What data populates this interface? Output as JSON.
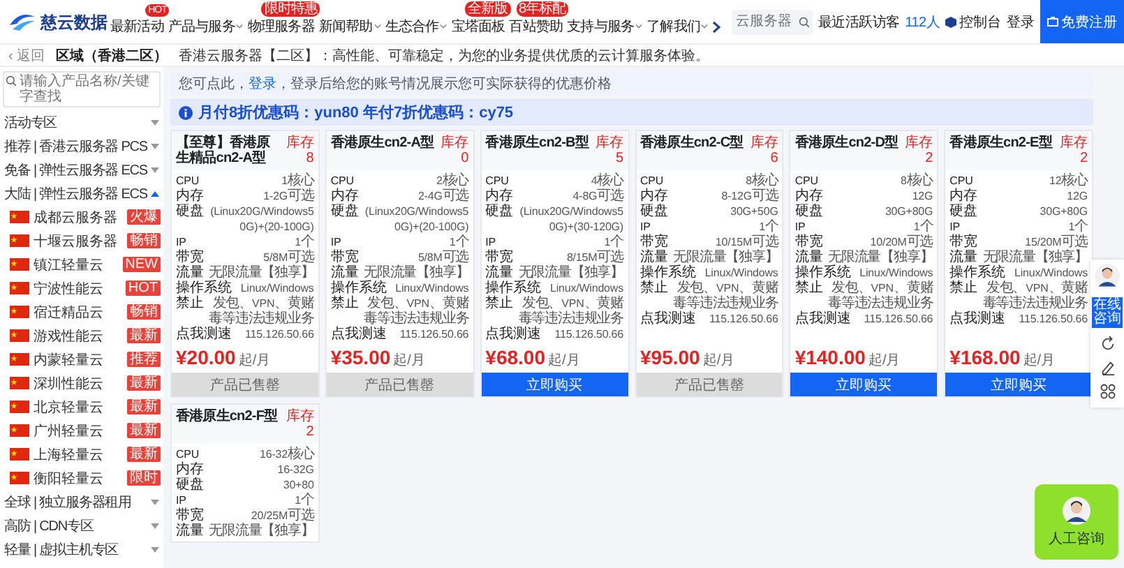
{
  "header": {
    "logo": "慈云数据",
    "nav": [
      {
        "label": "最新活动",
        "dropdown": false,
        "badge": "HOT"
      },
      {
        "label": "产品与服务",
        "dropdown": true
      },
      {
        "label": "物理服务器",
        "dropdown": false,
        "badge": "限时特惠"
      },
      {
        "label": "新闻帮助",
        "dropdown": true
      },
      {
        "label": "生态合作",
        "dropdown": true
      },
      {
        "label": "宝塔面板",
        "dropdown": false,
        "badge": "全新版"
      },
      {
        "label": "百站赞助",
        "dropdown": false,
        "badge": "8年标配"
      },
      {
        "label": "支持与服务",
        "dropdown": true
      },
      {
        "label": "了解我们",
        "dropdown": true
      }
    ],
    "search": {
      "placeholder": "云服务器"
    },
    "visitors_label": "最近活跃访客",
    "visitors_count": "112人",
    "console": "控制台",
    "login": "登录",
    "register": "免费注册"
  },
  "breadcrumb": {
    "back": "‹ 返回",
    "title": "区域（香港二区）",
    "description": "香港云服务器【二区】：高性能、可靠稳定，为您的业务提供优质的云计算服务体验。"
  },
  "sidebar": {
    "search": {
      "placeholder": "请输入产品名称/关键字查找"
    },
    "groups": [
      {
        "label": "活动专区",
        "expanded": false
      },
      {
        "label": "推荐 | 香港云服务器 PCS",
        "expanded": false
      },
      {
        "label": "免备 | 弹性云服务器 ECS",
        "expanded": false
      },
      {
        "label": "大陆 | 弹性云服务器 ECS",
        "expanded": true,
        "children": [
          {
            "label": "成都云服务器",
            "badge": "火爆"
          },
          {
            "label": "十堰云服务器",
            "badge": "畅销"
          },
          {
            "label": "镇江轻量云",
            "badge": "NEW"
          },
          {
            "label": "宁波性能云",
            "badge": "HOT"
          },
          {
            "label": "宿迁精品云",
            "badge": "畅销"
          },
          {
            "label": "游戏性能云",
            "badge": "最新"
          },
          {
            "label": "内蒙轻量云",
            "badge": "推荐"
          },
          {
            "label": "深圳性能云",
            "badge": "最新"
          },
          {
            "label": "北京轻量云",
            "badge": "最新"
          },
          {
            "label": "广州轻量云",
            "badge": "最新"
          },
          {
            "label": "上海轻量云",
            "badge": "最新"
          },
          {
            "label": "衡阳轻量云",
            "badge": "限时"
          }
        ]
      },
      {
        "label": "全球 | 独立服务器租用",
        "expanded": false
      },
      {
        "label": "高防 | CDN专区",
        "expanded": false
      },
      {
        "label": "轻量 | 虚拟主机专区",
        "expanded": false
      }
    ]
  },
  "notice": {
    "prefix": "您可点此，",
    "link": "登录",
    "suffix": "，登录后给您的账号情况展示您可实际获得的优惠价格"
  },
  "promo": "月付8折优惠码：yun80 年付7折优惠码：cy75",
  "plans": [
    {
      "title": "【至尊】香港原生精品cn2-A型",
      "stock": "库存8",
      "specs": [
        {
          "label": "CPU",
          "value": "1核心"
        },
        {
          "label": "内存",
          "value": "1-2G可选"
        },
        {
          "label": "硬盘",
          "value": "(Linux20G/Windows50G)+(20-100G)"
        },
        {
          "label": "IP",
          "value": "1个"
        },
        {
          "label": "带宽",
          "value": "5/8M可选"
        },
        {
          "label": "流量",
          "value": "无限流量【独享】"
        },
        {
          "label": "操作系统",
          "value": "Linux/Windows"
        },
        {
          "label": "禁止",
          "value": "发包、VPN、黄赌毒等违法违规业务"
        },
        {
          "label": "点我测速",
          "value": "115.126.50.66"
        }
      ],
      "price": "¥20.00",
      "unit": "起/月",
      "button": {
        "label": "产品已售罄",
        "kind": "soldout"
      }
    },
    {
      "title": "香港原生cn2-A型",
      "stock": "库存0",
      "specs": [
        {
          "label": "CPU",
          "value": "2核心"
        },
        {
          "label": "内存",
          "value": "2-4G可选"
        },
        {
          "label": "硬盘",
          "value": "(Linux20G/Windows50G)+(20-100G)"
        },
        {
          "label": "IP",
          "value": "1个"
        },
        {
          "label": "带宽",
          "value": "5/8M可选"
        },
        {
          "label": "流量",
          "value": "无限流量【独享】"
        },
        {
          "label": "操作系统",
          "value": "Linux/Windows"
        },
        {
          "label": "禁止",
          "value": "发包、VPN、黄赌毒等违法违规业务"
        },
        {
          "label": "点我测速",
          "value": "115.126.50.66"
        }
      ],
      "price": "¥35.00",
      "unit": "起/月",
      "button": {
        "label": "产品已售罄",
        "kind": "soldout"
      }
    },
    {
      "title": "香港原生cn2-B型",
      "stock": "库存5",
      "specs": [
        {
          "label": "CPU",
          "value": "4核心"
        },
        {
          "label": "内存",
          "value": "4-8G可选"
        },
        {
          "label": "硬盘",
          "value": "(Linux20G/Windows50G)+(30-120G)"
        },
        {
          "label": "IP",
          "value": "1个"
        },
        {
          "label": "带宽",
          "value": "8/15M可选"
        },
        {
          "label": "流量",
          "value": "无限流量【独享】"
        },
        {
          "label": "操作系统",
          "value": "Linux/Windows"
        },
        {
          "label": "禁止",
          "value": "发包、VPN、黄赌毒等违法违规业务"
        },
        {
          "label": "点我测速",
          "value": "115.126.50.66"
        }
      ],
      "price": "¥68.00",
      "unit": "起/月",
      "button": {
        "label": "立即购买",
        "kind": "buy"
      }
    },
    {
      "title": "香港原生cn2-C型",
      "stock": "库存6",
      "specs": [
        {
          "label": "CPU",
          "value": "8核心"
        },
        {
          "label": "内存",
          "value": "8-12G可选"
        },
        {
          "label": "硬盘",
          "value": "30G+50G"
        },
        {
          "label": "IP",
          "value": "1个"
        },
        {
          "label": "带宽",
          "value": "10/15M可选"
        },
        {
          "label": "流量",
          "value": "无限流量【独享】"
        },
        {
          "label": "操作系统",
          "value": "Linux/Windows"
        },
        {
          "label": "禁止",
          "value": "发包、VPN、黄赌毒等违法违规业务"
        },
        {
          "label": "点我测速",
          "value": "115.126.50.66"
        }
      ],
      "price": "¥95.00",
      "unit": "起/月",
      "button": {
        "label": "产品已售罄",
        "kind": "soldout"
      }
    },
    {
      "title": "香港原生cn2-D型",
      "stock": "库存2",
      "specs": [
        {
          "label": "CPU",
          "value": "8核心"
        },
        {
          "label": "内存",
          "value": "12G"
        },
        {
          "label": "硬盘",
          "value": "30G+80G"
        },
        {
          "label": "IP",
          "value": "1个"
        },
        {
          "label": "带宽",
          "value": "10/20M可选"
        },
        {
          "label": "流量",
          "value": "无限流量【独享】"
        },
        {
          "label": "操作系统",
          "value": "Linux/Windows"
        },
        {
          "label": "禁止",
          "value": "发包、VPN、黄赌毒等违法违规业务"
        },
        {
          "label": "点我测速",
          "value": "115.126.50.66"
        }
      ],
      "price": "¥140.00",
      "unit": "起/月",
      "button": {
        "label": "立即购买",
        "kind": "buy"
      }
    },
    {
      "title": "香港原生cn2-E型",
      "stock": "库存2",
      "specs": [
        {
          "label": "CPU",
          "value": "12核心"
        },
        {
          "label": "内存",
          "value": "12G"
        },
        {
          "label": "硬盘",
          "value": "30G+80G"
        },
        {
          "label": "IP",
          "value": "1个"
        },
        {
          "label": "带宽",
          "value": "15/20M可选"
        },
        {
          "label": "流量",
          "value": "无限流量【独享】"
        },
        {
          "label": "操作系统",
          "value": "Linux/Windows"
        },
        {
          "label": "禁止",
          "value": "发包、VPN、黄赌毒等违法违规业务"
        },
        {
          "label": "点我测速",
          "value": "115.126.50.66"
        }
      ],
      "price": "¥168.00",
      "unit": "起/月",
      "button": {
        "label": "立即购买",
        "kind": "buy"
      }
    },
    {
      "title": "香港原生cn2-F型",
      "stock": "库存2",
      "specs": [
        {
          "label": "CPU",
          "value": "16-32核心"
        },
        {
          "label": "内存",
          "value": "16-32G"
        },
        {
          "label": "硬盘",
          "value": "30+80"
        },
        {
          "label": "IP",
          "value": "1个"
        },
        {
          "label": "带宽",
          "value": "20/25M可选"
        },
        {
          "label": "流量",
          "value": "无限流量【独享】"
        }
      ]
    }
  ],
  "float_bar": {
    "chat": "在线咨询"
  },
  "help": {
    "label": "人工咨询"
  }
}
